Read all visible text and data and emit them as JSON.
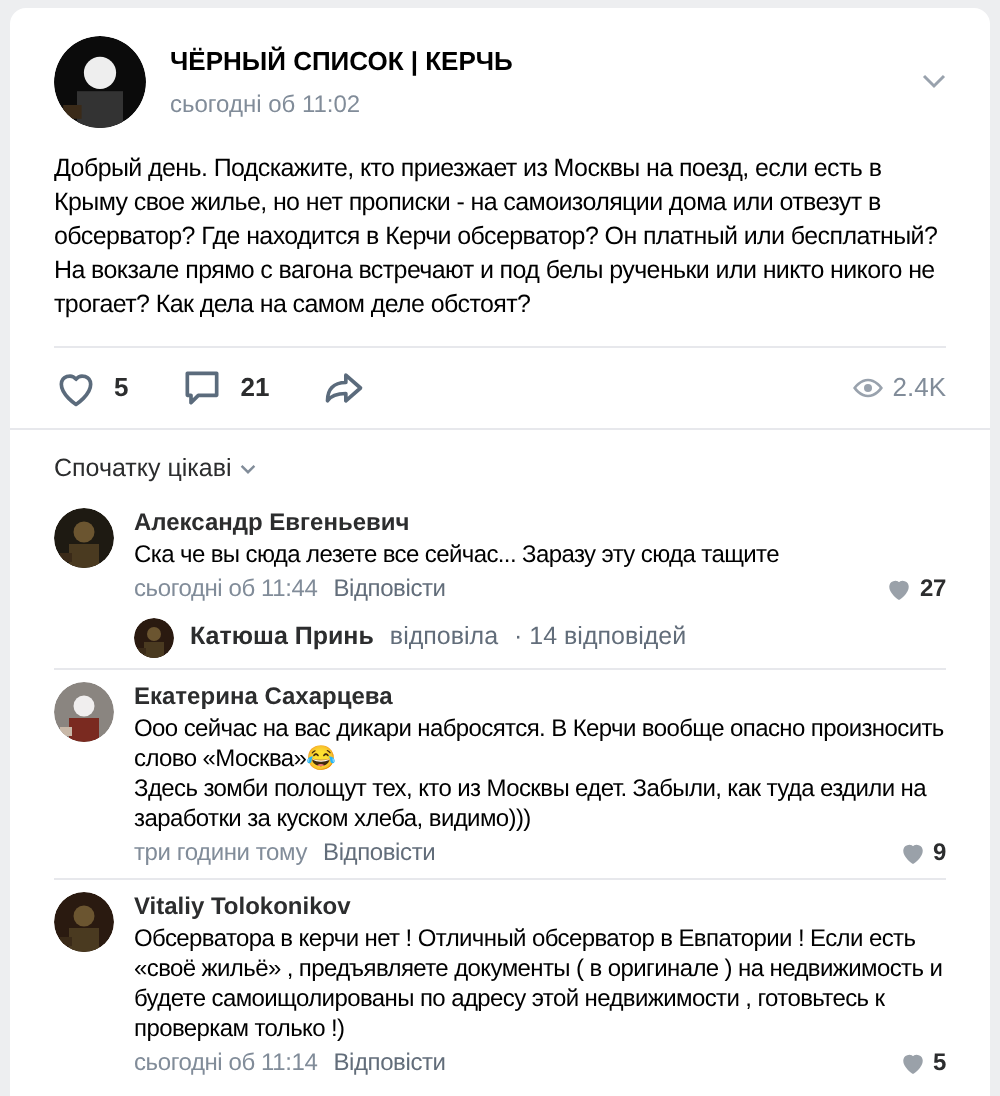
{
  "post": {
    "author": "ЧЁРНЫЙ СПИСОК | КЕРЧЬ",
    "time": "сьогодні об 11:02",
    "text": "Добрый день. Подскажите, кто приезжает из Москвы на поезд, если есть в Крыму свое жилье, но нет прописки - на самоизоляции дома или отвезут в обсерватор? Где находится в Керчи обсерватор? Он платный или бесплатный? На вокзале прямо с вагона встречают и под белы рученьки или никто никого не трогает? Как дела на самом деле обстоят?",
    "likes": "5",
    "comments": "21",
    "views": "2.4K"
  },
  "sort": "Спочатку цікаві",
  "comments": [
    {
      "author": "Александр Евгеньевич",
      "text": "Ска че вы сюда лезете все сейчас... Заразу эту сюда тащите",
      "time": "сьогодні об 11:44",
      "reply": "Відповісти",
      "likes": "27",
      "thread": {
        "author": "Катюша Принь",
        "action": "відповіла",
        "count": "· 14 відповідей"
      }
    },
    {
      "author": "Екатерина Сахарцева",
      "text": "Ооо сейчас на вас дикари набросятся. В Керчи вообще опасно произносить слово «Москва»😂\nЗдесь зомби полощут тех, кто из Москвы едет. Забыли, как туда ездили на заработки за куском хлеба, видимо)))",
      "time": "три години тому",
      "reply": "Відповісти",
      "likes": "9"
    },
    {
      "author": "Vitaliy Tolokonikov",
      "text": "Обсерватора в керчи нет ! Отличный обсерватор в Евпатории ! Если есть «своё жильё» , предъявляете документы ( в оригинале ) на недвижимость и будете самоищолированы по адресу этой недвижимости , готовьтесь к проверкам только !)",
      "time": "сьогодні об 11:14",
      "reply": "Відповісти",
      "likes": "5"
    }
  ]
}
